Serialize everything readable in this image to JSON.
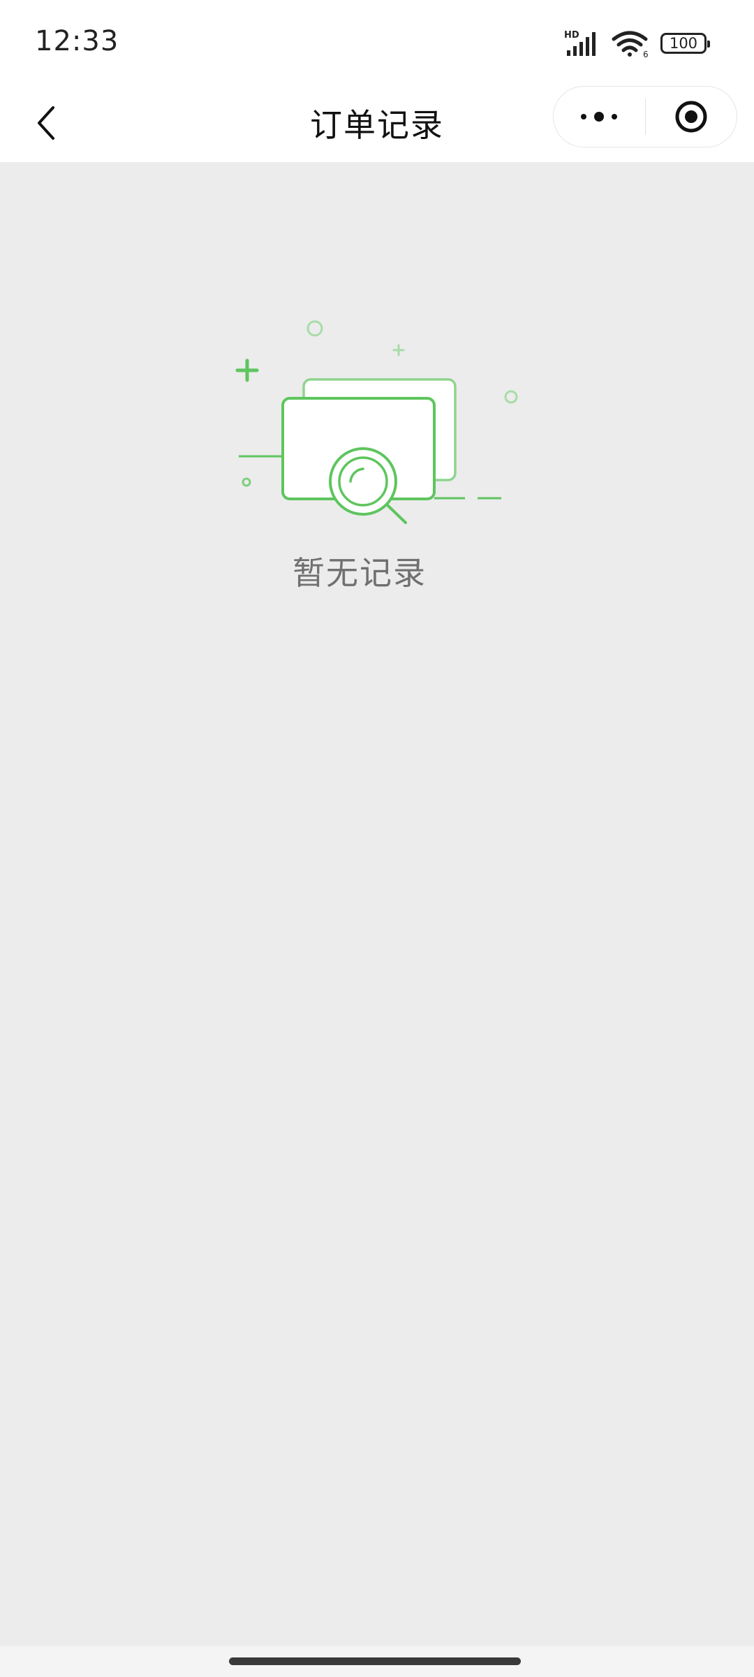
{
  "status_bar": {
    "time": "12:33",
    "battery": "100",
    "network_label": "HD",
    "wifi_label": "6"
  },
  "nav": {
    "title": "订单记录",
    "back_icon": "chevron-left-icon",
    "more_icon": "more-dots-icon",
    "close_icon": "target-circle-icon"
  },
  "empty_state": {
    "illustration_icon": "empty-search-illustration",
    "message": "暂无记录"
  },
  "colors": {
    "accent_green": "#5ec55e",
    "light_green": "#a8dca8",
    "background": "#ececec"
  }
}
